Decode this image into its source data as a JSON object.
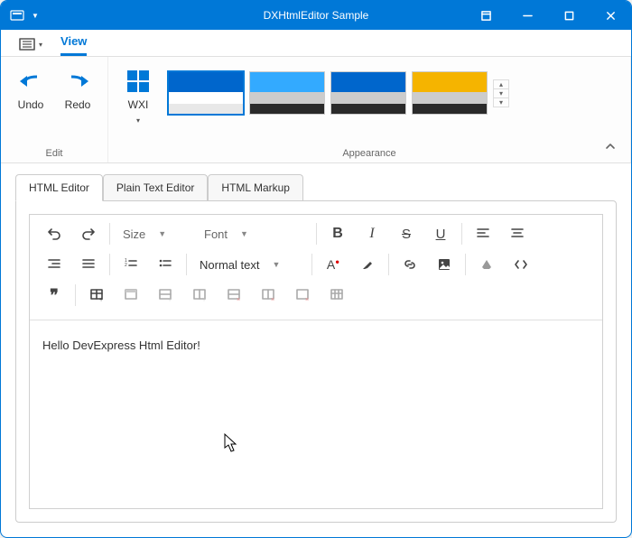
{
  "window": {
    "title": "DXHtmlEditor Sample"
  },
  "ribbon": {
    "tabs": {
      "view": "View"
    },
    "edit": {
      "undo": "Undo",
      "redo": "Redo",
      "label": "Edit"
    },
    "skin": {
      "wxi": "WXI"
    },
    "appearance": {
      "label": "Appearance"
    },
    "swatches": [
      {
        "c1": "#0066cc",
        "c2": "#ffffff",
        "c3": "#e8e8e8",
        "selected": true
      },
      {
        "c1": "#33aaff",
        "c2": "#cccccc",
        "c3": "#2a2a2a",
        "selected": false
      },
      {
        "c1": "#0066cc",
        "c2": "#cccccc",
        "c3": "#2a2a2a",
        "selected": false
      },
      {
        "c1": "#f5b400",
        "c2": "#cccccc",
        "c3": "#2a2a2a",
        "selected": false
      }
    ]
  },
  "sheets": {
    "html_editor": "HTML Editor",
    "plain_text": "Plain Text Editor",
    "html_markup": "HTML Markup"
  },
  "toolbar": {
    "size": "Size",
    "font": "Font",
    "normal_text": "Normal text"
  },
  "editor": {
    "content": "Hello DevExpress Html Editor!"
  }
}
